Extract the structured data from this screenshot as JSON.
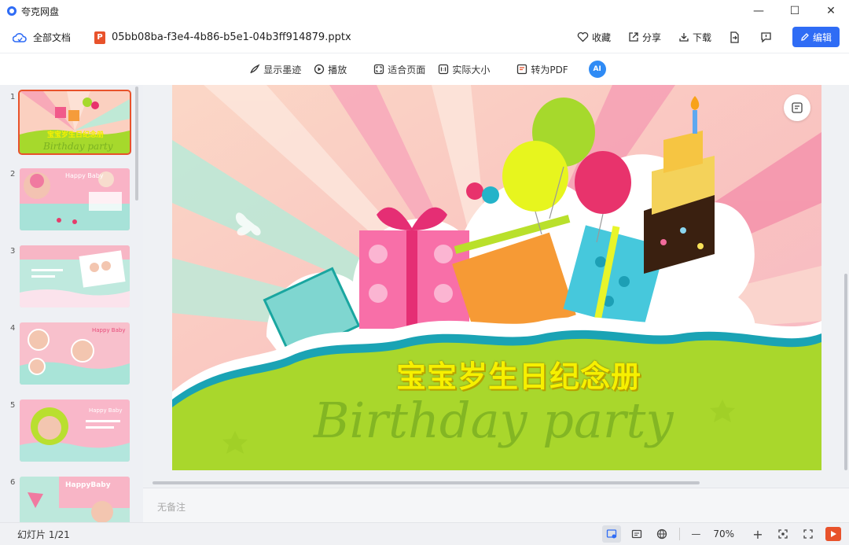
{
  "app": {
    "name": "夸克网盘"
  },
  "window": {
    "minimize": "—",
    "maximize": "☐",
    "close": "✕"
  },
  "header": {
    "crumb_label": "全部文档",
    "file_name": "05bb08ba-f3e4-4b86-b5e1-04b3ff914879.pptx",
    "file_badge": "P",
    "actions": {
      "favorite": "收藏",
      "share": "分享",
      "download": "下载"
    },
    "edit_label": "编辑"
  },
  "toolbar": {
    "show_ink": "显示墨迹",
    "play": "播放",
    "fit_page": "适合页面",
    "actual_size": "实际大小",
    "to_pdf": "转为PDF",
    "ai_label": "AI"
  },
  "thumbnails": [
    {
      "num": "1",
      "label": "宝宝岁生日纪念册",
      "sub": "Birthday party"
    },
    {
      "num": "2",
      "label": "Happy Baby"
    },
    {
      "num": "3"
    },
    {
      "num": "4",
      "label": "Happy Baby"
    },
    {
      "num": "5",
      "label": "Happy Baby"
    },
    {
      "num": "6",
      "label": "HappyBaby"
    }
  ],
  "slide": {
    "title": "宝宝岁生日纪念册",
    "subtitle": "Birthday party"
  },
  "notes": {
    "placeholder": "无备注"
  },
  "status": {
    "slide_count": "幻灯片 1/21",
    "zoom": "70%",
    "zoom_out": "—",
    "zoom_in": "+"
  },
  "colors": {
    "accent": "#2f6cf5",
    "ppt": "#e8522b"
  }
}
